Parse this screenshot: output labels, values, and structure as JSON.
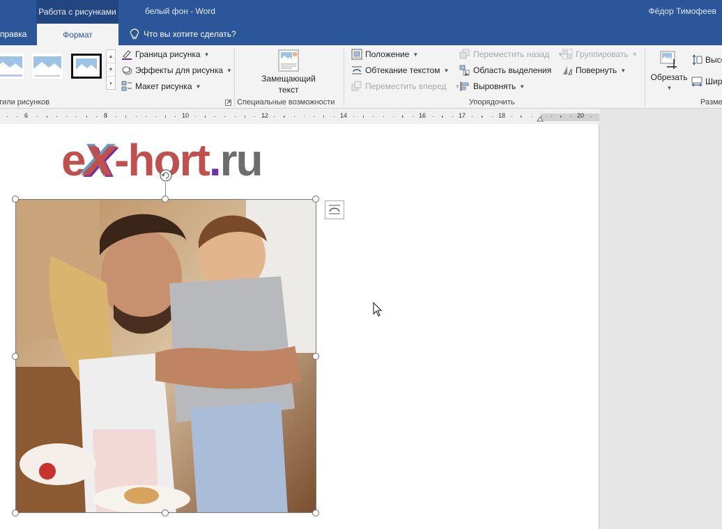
{
  "titlebar": {
    "context_group": "Работа с рисунками",
    "doc_title": "белый фон  -  Word",
    "user": "Фёдор Тимофеев"
  },
  "tabs": {
    "help": "правка",
    "format": "Формат",
    "tell_me": "Что вы хотите сделать?"
  },
  "ribbon": {
    "styles": {
      "group_label": "тили рисунков"
    },
    "picture": {
      "border": "Граница рисунка",
      "effects": "Эффекты для рисунка",
      "layout": "Макет рисунка"
    },
    "accessibility": {
      "alt_text_line1": "Замещающий",
      "alt_text_line2": "текст",
      "group_label": "Специальные возможности"
    },
    "arrange": {
      "position": "Положение",
      "wrap_text": "Обтекание текстом",
      "bring_forward": "Переместить вперед",
      "send_backward": "Переместить назад",
      "selection_pane": "Область выделения",
      "align": "Выровнять",
      "group": "Группировать",
      "rotate": "Повернуть",
      "group_label": "Упорядочить"
    },
    "size": {
      "crop": "Обрезать",
      "height": "Высо",
      "width": "Шир",
      "group_label": "Разме"
    }
  },
  "ruler": {
    "labels": [
      "6",
      "8",
      "10",
      "12",
      "14",
      "16",
      "17",
      "18",
      "20"
    ]
  },
  "document": {
    "logo": {
      "part1": "e",
      "part2": "x",
      "part3": "-hort",
      "part4": ".",
      "part5": "ru"
    }
  },
  "colors": {
    "word_blue": "#2b579a",
    "logo_red": "#c0504d",
    "logo_gray": "#6d6d6d",
    "logo_purple": "#7030a0"
  }
}
